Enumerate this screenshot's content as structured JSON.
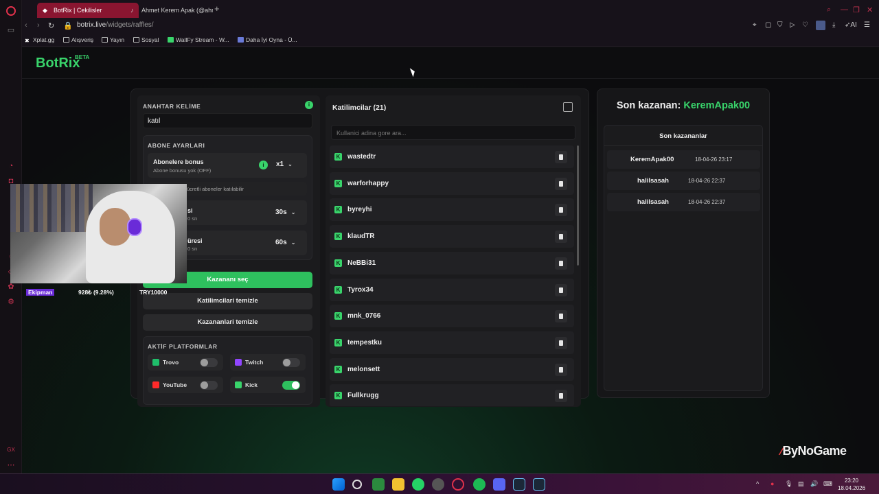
{
  "browser": {
    "tabs": [
      {
        "label": "BotRix | Cekilisler",
        "active": true
      },
      {
        "label": "Ahmet Kerem Apak (@ahm",
        "active": false
      }
    ],
    "url_main": "botrix.live",
    "url_path": "/widgets/raffles/",
    "bookmarks": [
      "Xplat.gg",
      "Alışveriş",
      "Yayın",
      "Sosyal",
      "WallFy Stream - W...",
      "Daha İyi Oyna - Ü..."
    ],
    "ai_label": "AI"
  },
  "app": {
    "logo": "BotRix",
    "beta": "BETA"
  },
  "keyword": {
    "label": "ANAHTAR KELİME",
    "value": "katıl"
  },
  "subscriber": {
    "section_label": "ABONE AYARLARI",
    "bonus_title": "Abonelere bonus",
    "bonus_sub": "Abone bonusu yok (OFF)",
    "bonus_multiplier": "x1",
    "note": "ücretli aboneler katılabilir",
    "timer1_title": "si",
    "timer1_sub": "0 sn",
    "timer1_value": "30s",
    "timer2_title": "üresi",
    "timer2_sub": "0 sn",
    "timer2_value": "60s"
  },
  "buttons": {
    "pick_winner": "Kazananı seç",
    "clear_participants": "Katilimcilari temizle",
    "clear_winners": "Kazananlari temizle"
  },
  "platforms": {
    "label": "AKTİF PLATFORMLAR",
    "items": [
      {
        "name": "Trovo",
        "on": false,
        "color": "#1fbe6a"
      },
      {
        "name": "Twitch",
        "on": false,
        "color": "#9146ff"
      },
      {
        "name": "YouTube",
        "on": false,
        "color": "#ff2a2a"
      },
      {
        "name": "Kick",
        "on": true,
        "color": "#39d46b"
      }
    ]
  },
  "overlay": {
    "name": "Ekipman",
    "pct": "928₺ (9.28%)",
    "currency": "TRY10000"
  },
  "participants": {
    "title": "Katilimcilar (21)",
    "search_placeholder": "Kullanici adina gore ara...",
    "list": [
      "wastedtr",
      "warforhappy",
      "byreyhi",
      "klaudTR",
      "NeBBi31",
      "Tyrox34",
      "mnk_0766",
      "tempestku",
      "melonsett",
      "Fullkrugg"
    ]
  },
  "winners": {
    "title_prefix": "Son kazanan:",
    "last_winner": "KeremApak00",
    "box_title": "Son kazananlar",
    "list": [
      {
        "name": "KeremApak00",
        "date": "18-04-26 23:17"
      },
      {
        "name": "halilsasah",
        "date": "18-04-26 22:37"
      },
      {
        "name": "halilsasah",
        "date": "18-04-26 22:37"
      }
    ]
  },
  "watermark": "ByNoGame",
  "taskbar": {
    "time": "23:20",
    "date": "18.04.2026"
  },
  "colors": {
    "accent": "#39d46b",
    "tab_active": "#8a1530"
  }
}
